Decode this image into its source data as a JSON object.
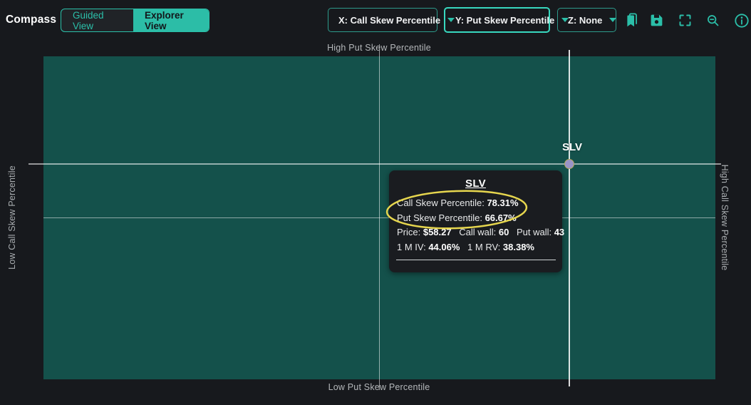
{
  "app_title": "Compass",
  "header": {
    "toggle": {
      "guided_label": "Guided View",
      "explorer_label": "Explorer View",
      "active": "Explorer View"
    },
    "dropdown_x": "X: Call Skew Percentile",
    "dropdown_y": "Y: Put Skew Percentile",
    "dropdown_z": "Z: None",
    "icons": [
      "bookmark-icon",
      "save-icon",
      "fullscreen-icon",
      "search-icon",
      "info-icon"
    ]
  },
  "chart_data": {
    "type": "scatter",
    "x_axis": "Call Skew Percentile",
    "y_axis": "Put Skew Percentile",
    "z_axis": "None",
    "x_range": [
      0,
      100
    ],
    "y_range": [
      0,
      100
    ],
    "grid": "quadrant midlines at 50/50",
    "quadrant_labels": {
      "top": "High Put Skew Percentile",
      "bottom": "Low Put Skew Percentile",
      "left": "Low Call Skew Percentile",
      "right": "High Call Skew Percentile"
    },
    "points": [
      {
        "symbol": "SLV",
        "x": 78.31,
        "y": 66.67,
        "crosshair": true
      }
    ]
  },
  "point_label": "SLV",
  "tooltip": {
    "title": "SLV",
    "row1_label": "Call Skew Percentile: ",
    "row1_value": "78.31%",
    "row2_label": "Put Skew Percentile: ",
    "row2_value": "66.67%",
    "row3": [
      {
        "label": "Price: ",
        "value": "$58.27"
      },
      {
        "label": "Call wall: ",
        "value": "60"
      },
      {
        "label": "Put wall: ",
        "value": "43"
      }
    ],
    "row4": [
      {
        "label": "1 M IV: ",
        "value": "44.06%"
      },
      {
        "label": "1 M RV: ",
        "value": "38.38%"
      }
    ]
  },
  "annotation": {
    "shape": "yellow-ellipse",
    "highlights": "Call & Put Skew Percentile rows",
    "color": "#e6d64e"
  },
  "colors": {
    "accent_teal": "#2bbfa9",
    "plot_bg": "#14514b",
    "page_bg": "#17191d",
    "tooltip_bg": "#1a1c20",
    "point_fill": "#9b94c6",
    "point_ring": "#b3a75a",
    "annotation_yellow": "#e6d64e"
  }
}
